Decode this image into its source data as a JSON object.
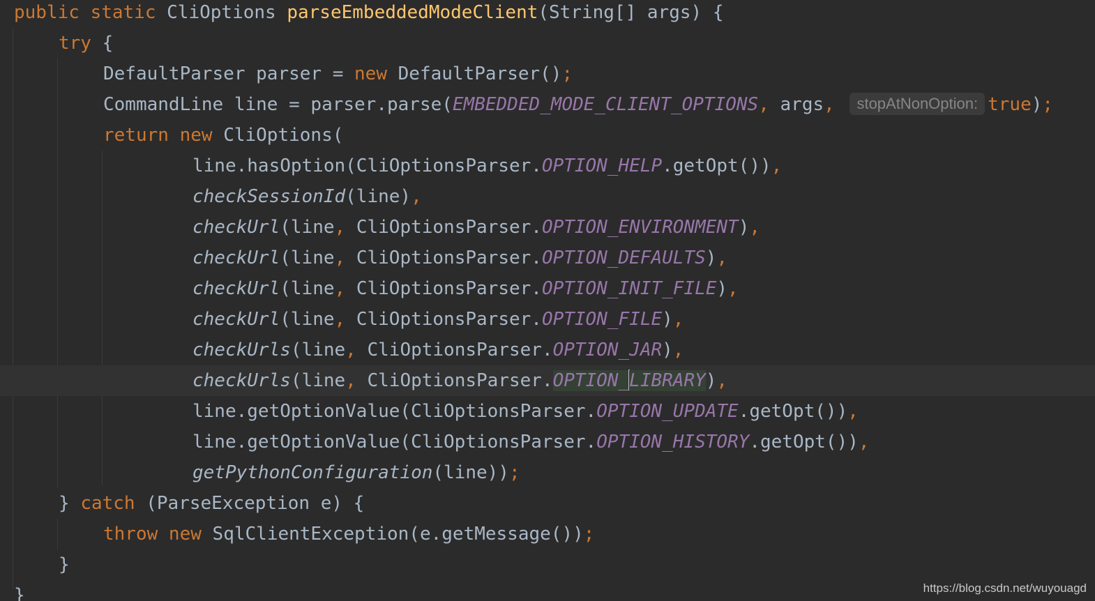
{
  "theme": {
    "background": "#2b2b2b",
    "keyword": "#cc7832",
    "plain": "#a9b7c6",
    "method_declaration": "#ffc66d",
    "static_field": "#9876aa",
    "current_line": "#323232",
    "inlay_hint": "#868686"
  },
  "code": {
    "lines": [
      [
        {
          "t": "public static ",
          "k": "kw"
        },
        {
          "t": "CliOptions ",
          "k": "plain"
        },
        {
          "t": "parseEmbeddedModeClient",
          "k": "decl"
        },
        {
          "t": "(String[] args) {",
          "k": "plain"
        }
      ],
      [
        {
          "t": "try ",
          "k": "kw"
        },
        {
          "t": "{",
          "k": "plain"
        }
      ],
      [
        {
          "t": "DefaultParser parser = ",
          "k": "plain"
        },
        {
          "t": "new ",
          "k": "kw"
        },
        {
          "t": "DefaultParser()",
          "k": "plain"
        },
        {
          "t": ";",
          "k": "kw"
        }
      ],
      [
        {
          "t": "CommandLine line = parser.parse(",
          "k": "plain"
        },
        {
          "t": "EMBEDDED_MODE_CLIENT_OPTIONS",
          "k": "field"
        },
        {
          "t": ", ",
          "k": "kw"
        },
        {
          "t": "args",
          "k": "plain"
        },
        {
          "t": ", ",
          "k": "kw"
        },
        {
          "t": "stopAtNonOption:",
          "k": "hint"
        },
        {
          "t": "true",
          "k": "kw"
        },
        {
          "t": ")",
          "k": "plain"
        },
        {
          "t": ";",
          "k": "kw"
        }
      ],
      [
        {
          "t": "return new ",
          "k": "kw"
        },
        {
          "t": "CliOptions(",
          "k": "plain"
        }
      ],
      [
        {
          "t": "line.hasOption(CliOptionsParser.",
          "k": "plain"
        },
        {
          "t": "OPTION_HELP",
          "k": "field"
        },
        {
          "t": ".getOpt())",
          "k": "plain"
        },
        {
          "t": ",",
          "k": "kw"
        }
      ],
      [
        {
          "t": "checkSessionId",
          "k": "static"
        },
        {
          "t": "(line)",
          "k": "plain"
        },
        {
          "t": ",",
          "k": "kw"
        }
      ],
      [
        {
          "t": "checkUrl",
          "k": "static"
        },
        {
          "t": "(line",
          "k": "plain"
        },
        {
          "t": ", ",
          "k": "kw"
        },
        {
          "t": "CliOptionsParser.",
          "k": "plain"
        },
        {
          "t": "OPTION_ENVIRONMENT",
          "k": "field"
        },
        {
          "t": ")",
          "k": "plain"
        },
        {
          "t": ",",
          "k": "kw"
        }
      ],
      [
        {
          "t": "checkUrl",
          "k": "static"
        },
        {
          "t": "(line",
          "k": "plain"
        },
        {
          "t": ", ",
          "k": "kw"
        },
        {
          "t": "CliOptionsParser.",
          "k": "plain"
        },
        {
          "t": "OPTION_DEFAULTS",
          "k": "field"
        },
        {
          "t": ")",
          "k": "plain"
        },
        {
          "t": ",",
          "k": "kw"
        }
      ],
      [
        {
          "t": "checkUrl",
          "k": "static"
        },
        {
          "t": "(line",
          "k": "plain"
        },
        {
          "t": ", ",
          "k": "kw"
        },
        {
          "t": "CliOptionsParser.",
          "k": "plain"
        },
        {
          "t": "OPTION_INIT_FILE",
          "k": "field"
        },
        {
          "t": ")",
          "k": "plain"
        },
        {
          "t": ",",
          "k": "kw"
        }
      ],
      [
        {
          "t": "checkUrl",
          "k": "static"
        },
        {
          "t": "(line",
          "k": "plain"
        },
        {
          "t": ", ",
          "k": "kw"
        },
        {
          "t": "CliOptionsParser.",
          "k": "plain"
        },
        {
          "t": "OPTION_FILE",
          "k": "field"
        },
        {
          "t": ")",
          "k": "plain"
        },
        {
          "t": ",",
          "k": "kw"
        }
      ],
      [
        {
          "t": "checkUrls",
          "k": "static"
        },
        {
          "t": "(line",
          "k": "plain"
        },
        {
          "t": ", ",
          "k": "kw"
        },
        {
          "t": "CliOptionsParser.",
          "k": "plain"
        },
        {
          "t": "OPTION_JAR",
          "k": "field"
        },
        {
          "t": ")",
          "k": "plain"
        },
        {
          "t": ",",
          "k": "kw"
        }
      ],
      [
        {
          "t": "checkUrls",
          "k": "static"
        },
        {
          "t": "(line",
          "k": "plain"
        },
        {
          "t": ", ",
          "k": "kw"
        },
        {
          "t": "CliOptionsParser.",
          "k": "plain"
        },
        {
          "t": "OPTION_",
          "k": "field-hl"
        },
        {
          "t": "",
          "k": "caret"
        },
        {
          "t": "LIBRARY",
          "k": "field-hl"
        },
        {
          "t": ")",
          "k": "plain"
        },
        {
          "t": ",",
          "k": "kw"
        }
      ],
      [
        {
          "t": "line.getOptionValue(CliOptionsParser.",
          "k": "plain"
        },
        {
          "t": "OPTION_UPDATE",
          "k": "field"
        },
        {
          "t": ".getOpt())",
          "k": "plain"
        },
        {
          "t": ",",
          "k": "kw"
        }
      ],
      [
        {
          "t": "line.getOptionValue(CliOptionsParser.",
          "k": "plain"
        },
        {
          "t": "OPTION_HISTORY",
          "k": "field"
        },
        {
          "t": ".getOpt())",
          "k": "plain"
        },
        {
          "t": ",",
          "k": "kw"
        }
      ],
      [
        {
          "t": "getPythonConfiguration",
          "k": "static"
        },
        {
          "t": "(line))",
          "k": "plain"
        },
        {
          "t": ";",
          "k": "kw"
        }
      ],
      [
        {
          "t": "} ",
          "k": "plain"
        },
        {
          "t": "catch ",
          "k": "kw"
        },
        {
          "t": "(ParseException e) {",
          "k": "plain"
        }
      ],
      [
        {
          "t": "throw new ",
          "k": "kw"
        },
        {
          "t": "SqlClientException(e.getMessage())",
          "k": "plain"
        },
        {
          "t": ";",
          "k": "kw"
        }
      ],
      [
        {
          "t": "}",
          "k": "plain"
        }
      ],
      [
        {
          "t": "}",
          "k": "plain"
        }
      ]
    ]
  },
  "watermark": "https://blog.csdn.net/wuyouagd"
}
